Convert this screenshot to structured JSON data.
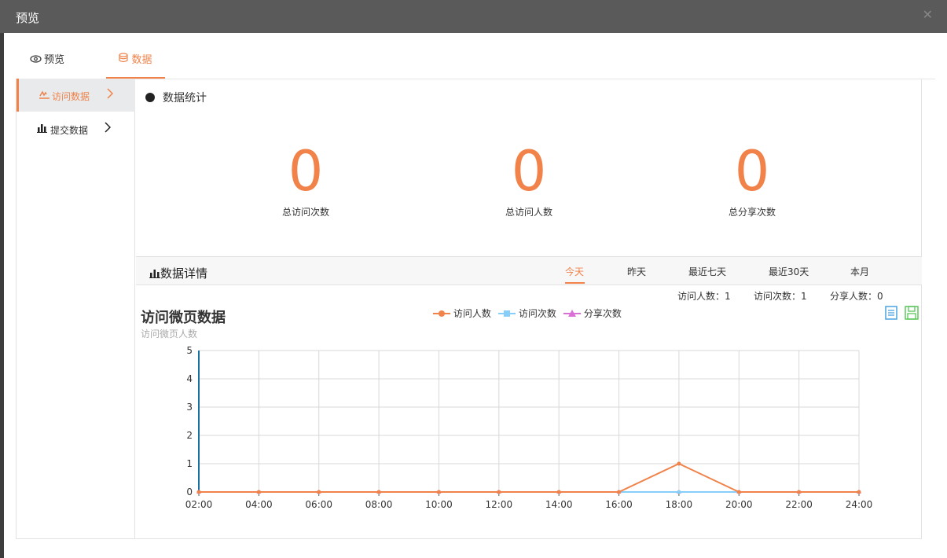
{
  "dialog": {
    "title": "预览",
    "close": "✕"
  },
  "tabs": [
    {
      "label": "预览",
      "icon": "eye-icon"
    },
    {
      "label": "数据",
      "icon": "database-icon",
      "active": true
    }
  ],
  "sidebar": {
    "items": [
      {
        "label": "访问数据",
        "icon": "pulse-icon",
        "active": true
      },
      {
        "label": "提交数据",
        "icon": "bar-chart-icon"
      }
    ]
  },
  "stats": {
    "title": "数据统计",
    "items": [
      {
        "value": "0",
        "label": "总访问次数"
      },
      {
        "value": "0",
        "label": "总访问人数"
      },
      {
        "value": "0",
        "label": "总分享次数"
      }
    ]
  },
  "detail": {
    "title": "数据详情",
    "ranges": [
      "今天",
      "昨天",
      "最近七天",
      "最近30天",
      "本月"
    ],
    "active_range": "今天",
    "summary": [
      {
        "text": "访问人数：1"
      },
      {
        "text": "访问次数：1"
      },
      {
        "text": "分享人数：0"
      }
    ]
  },
  "chart": {
    "title": "访问微页数据",
    "subtitle": "访问微页人数"
  },
  "colors": {
    "accent": "#f0824a",
    "series_visitors": "#f0824a",
    "series_visits": "#87cefa",
    "series_shares": "#da70d6"
  },
  "chart_data": {
    "type": "line",
    "title": "访问微页数据",
    "subtitle": "访问微页人数",
    "x": [
      "02:00",
      "04:00",
      "06:00",
      "08:00",
      "10:00",
      "12:00",
      "14:00",
      "16:00",
      "18:00",
      "20:00",
      "22:00",
      "24:00"
    ],
    "ylim": [
      0,
      5
    ],
    "yticks": [
      0,
      1,
      2,
      3,
      4,
      5
    ],
    "grid": true,
    "legend_position": "top-center",
    "series": [
      {
        "name": "访问人数",
        "marker": "circle",
        "color": "#f0824a",
        "values": [
          0,
          0,
          0,
          0,
          0,
          0,
          0,
          0,
          1,
          0,
          0,
          0
        ]
      },
      {
        "name": "访问次数",
        "marker": "square",
        "color": "#87cefa",
        "values": [
          0,
          0,
          0,
          0,
          0,
          0,
          0,
          0,
          0,
          0,
          0,
          0
        ]
      },
      {
        "name": "分享次数",
        "marker": "triangle",
        "color": "#da70d6",
        "values": [
          0,
          0,
          0,
          0,
          0,
          0,
          0,
          0,
          0,
          0,
          0,
          0
        ]
      }
    ]
  }
}
